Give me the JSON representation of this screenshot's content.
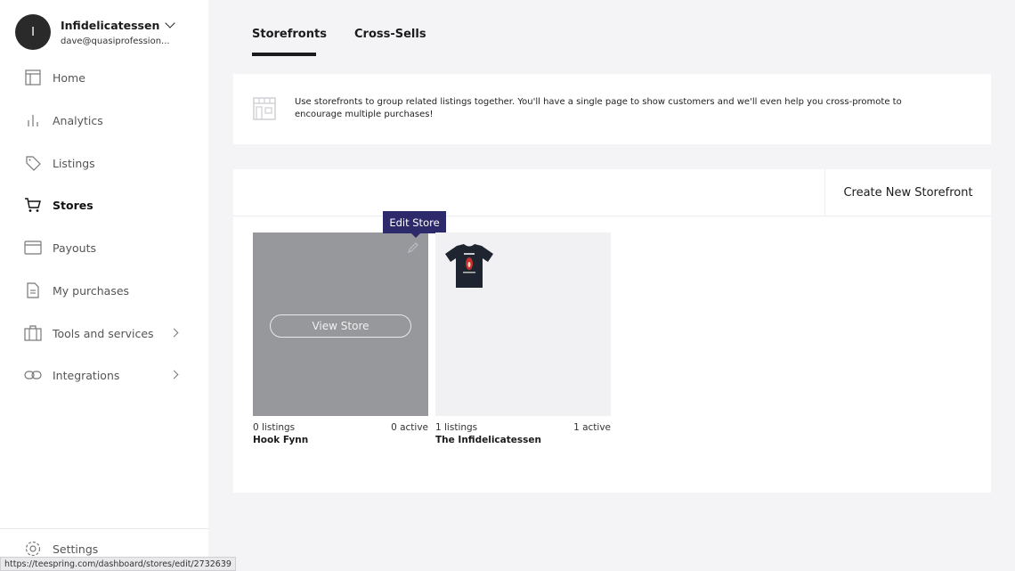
{
  "account": {
    "avatar_initial": "I",
    "name": "Infidelicatessen",
    "email": "dave@quasiprofession..."
  },
  "sidebar": {
    "items": [
      {
        "label": "Home",
        "icon": "home-layout-icon"
      },
      {
        "label": "Analytics",
        "icon": "bar-chart-icon"
      },
      {
        "label": "Listings",
        "icon": "tag-icon"
      },
      {
        "label": "Stores",
        "icon": "cart-icon",
        "active": true
      },
      {
        "label": "Payouts",
        "icon": "credit-card-icon"
      },
      {
        "label": "My purchases",
        "icon": "document-icon"
      },
      {
        "label": "Tools and services",
        "icon": "toolbox-icon",
        "expandable": true
      },
      {
        "label": "Integrations",
        "icon": "link-icon",
        "expandable": true
      }
    ],
    "settings_label": "Settings"
  },
  "tabs": [
    {
      "label": "Storefronts",
      "active": true
    },
    {
      "label": "Cross-Sells",
      "active": false
    }
  ],
  "info": {
    "text": "Use storefronts to group related listings together. You'll have a single page to show customers and we'll even help you cross-promote to encourage multiple purchases!"
  },
  "stores": {
    "create_label": "Create New Storefront",
    "tooltip": "Edit Store",
    "view_label": "View Store",
    "list": [
      {
        "name": "Hook Fynn",
        "listings": "0 listings",
        "active": "0 active"
      },
      {
        "name": "The Infidelicatessen",
        "listings": "1 listings",
        "active": "1 active"
      }
    ]
  },
  "status_bar": {
    "url": "https://teespring.com/dashboard/stores/edit/2732639"
  },
  "colors": {
    "tooltip_bg": "#2d2a6b",
    "tile_hover_overlay": "#97989b",
    "page_bg": "#f4f4f6"
  }
}
